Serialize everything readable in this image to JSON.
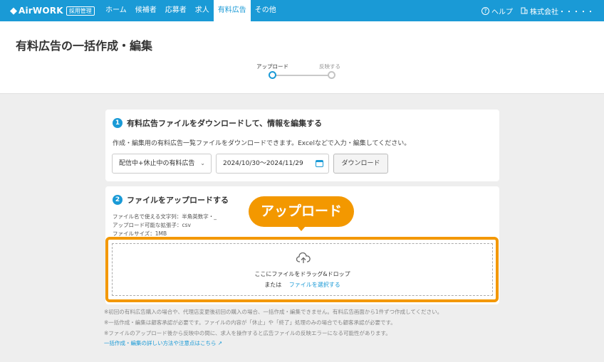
{
  "header": {
    "logo_mark": "◆",
    "logo_text": "AirWORK",
    "logo_badge": "採用管理",
    "nav": [
      {
        "label": "ホーム",
        "active": false
      },
      {
        "label": "候補者",
        "active": false
      },
      {
        "label": "応募者",
        "active": false
      },
      {
        "label": "求人",
        "active": false
      },
      {
        "label": "有料広告",
        "active": true
      },
      {
        "label": "その他",
        "active": false
      }
    ],
    "help_label": "ヘルプ",
    "company_label": "株式会社・・・・・"
  },
  "page": {
    "title": "有料広告の一括作成・編集",
    "steps": [
      "アップロード",
      "反映する"
    ]
  },
  "card1": {
    "number": "1",
    "title": "有料広告ファイルをダウンロードして、情報を編集する",
    "description": "作成・編集用の有料広告一覧ファイルをダウンロードできます。Excelなどで入力・編集してください。",
    "select_value": "配信中+休止中の有料広告",
    "date_range": "2024/10/30〜2024/11/29",
    "download_label": "ダウンロード"
  },
  "card2": {
    "number": "2",
    "title": "ファイルをアップロードする",
    "spec_chars": "ファイル名で使える文字列：半角英数字・_",
    "spec_ext": "アップロード可能な拡張子：csv",
    "spec_size": "ファイルサイズ：1MB",
    "drop_text": "ここにファイルをドラッグ&ドロップ",
    "or_text": "または",
    "select_file_label": "ファイルを選択する"
  },
  "callout": "アップロード",
  "notes": [
    "※初回の有料広告購入の場合や、代理店変更後初回の購入の場合、一括作成・編集できません。有料広告画面から1件ずつ作成してください。",
    "※一括作成・編集は顧客承認が必要です。ファイルの内容が「休止」や「終了」処理のみの場合でも顧客承認が必要です。",
    "※ファイルのアップロード後から反映中の間に、求人を操作すると広告ファイルの反映エラーになる可能性があります。"
  ],
  "help_link": "一括作成・編集の詳しい方法や注意点はこちら",
  "colors": {
    "brand": "#1a9ad6",
    "highlight": "#f39800"
  }
}
